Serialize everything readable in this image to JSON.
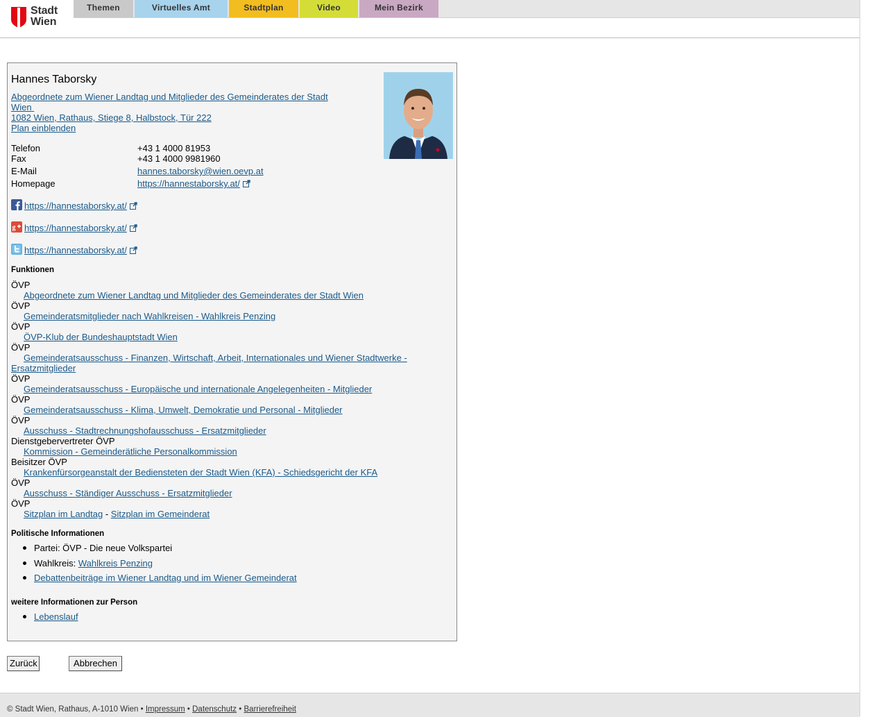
{
  "logo": {
    "line1": "Stadt",
    "line2": "Wien"
  },
  "nav": [
    {
      "label": "Themen"
    },
    {
      "label": "Virtuelles Amt"
    },
    {
      "label": "Stadtplan"
    },
    {
      "label": "Video"
    },
    {
      "label": "Mein Bezirk"
    }
  ],
  "person": {
    "name": "Hannes Taborsky",
    "role_link_line1": "Abgeordnete zum Wiener Landtag und Mitglieder des Gemeinderates der Stadt",
    "role_link_line2": "Wien",
    "address": "1082 Wien, Rathaus, Stiege 8, Halbstock, Tür 222",
    "map_link": "Plan einblenden"
  },
  "contact": {
    "phone_label": "Telefon",
    "phone": "+43 1 4000 81953",
    "fax_label": "Fax",
    "fax": "+43 1 4000 9981960",
    "email_label": "E-Mail",
    "email": "hannes.taborsky@wien.oevp.at",
    "homepage_label": "Homepage",
    "homepage": "https://hannestaborsky.at/"
  },
  "social": [
    {
      "icon": "facebook-icon",
      "url": "https://hannestaborsky.at/"
    },
    {
      "icon": "google-plus-icon",
      "url": "https://hannestaborsky.at/"
    },
    {
      "icon": "twitter-icon",
      "url": "https://hannestaborsky.at/"
    }
  ],
  "functions_heading": "Funktionen",
  "functions": [
    {
      "party": "ÖVP",
      "link": "Abgeordnete zum Wiener Landtag und Mitglieder des Gemeinderates der Stadt Wien"
    },
    {
      "party": "ÖVP",
      "link": "Gemeinderatsmitglieder nach Wahlkreisen - Wahlkreis Penzing"
    },
    {
      "party": "ÖVP",
      "link": "ÖVP-Klub der Bundeshauptstadt Wien"
    },
    {
      "party": "ÖVP",
      "link": "Gemeinderatsausschuss - Finanzen, Wirtschaft, Arbeit, Internationales und Wiener Stadtwerke - Ersatzmitglieder"
    },
    {
      "party": "ÖVP",
      "link": "Gemeinderatsausschuss - Europäische und internationale Angelegenheiten - Mitglieder"
    },
    {
      "party": "ÖVP",
      "link": "Gemeinderatsausschuss - Klima, Umwelt, Demokratie und Personal - Mitglieder"
    },
    {
      "party": "ÖVP",
      "link": "Ausschuss - Stadtrechnungshofausschuss - Ersatzmitglieder"
    },
    {
      "party": "Dienstgebervertreter ÖVP",
      "link": "Kommission - Gemeinderätliche Personalkommission"
    },
    {
      "party": "Beisitzer ÖVP",
      "link": "Krankenfürsorgeanstalt der Bediensteten der Stadt Wien (KFA) - Schiedsgericht der KFA"
    },
    {
      "party": "ÖVP",
      "link": "Ausschuss - Ständiger Ausschuss - Ersatzmitglieder"
    },
    {
      "party": "ÖVP",
      "link": "Sitzplan im Landtag",
      "separator": "-",
      "link2": "Sitzplan im Gemeinderat"
    }
  ],
  "political": {
    "heading": "Politische Informationen",
    "party_label": "Partei: ÖVP - Die neue Volkspartei",
    "district_prefix": "Wahlkreis:",
    "district_link": "Wahlkreis Penzing",
    "debates_link": "Debattenbeiträge im Wiener Landtag und im Wiener Gemeinderat"
  },
  "more": {
    "heading": "weitere Informationen zur Person",
    "cv_link": "Lebenslauf"
  },
  "buttons": {
    "back": "Zurück",
    "cancel": "Abbrechen"
  },
  "footer": {
    "copyright": "© Stadt Wien, Rathaus, A-1010 Wien •",
    "imprint": "Impressum",
    "sep1": "•",
    "privacy": "Datenschutz",
    "sep2": "•",
    "accessibility": "Barrierefreiheit"
  },
  "colors": {
    "link": "#1a5a8a",
    "tab_themen": "#c9c9c9",
    "tab_amt": "#a7d3ed",
    "tab_stadtplan": "#f2bd1f",
    "tab_video": "#d4dd38",
    "tab_bezirk": "#c9a8c3",
    "logo_red": "#e30613"
  }
}
